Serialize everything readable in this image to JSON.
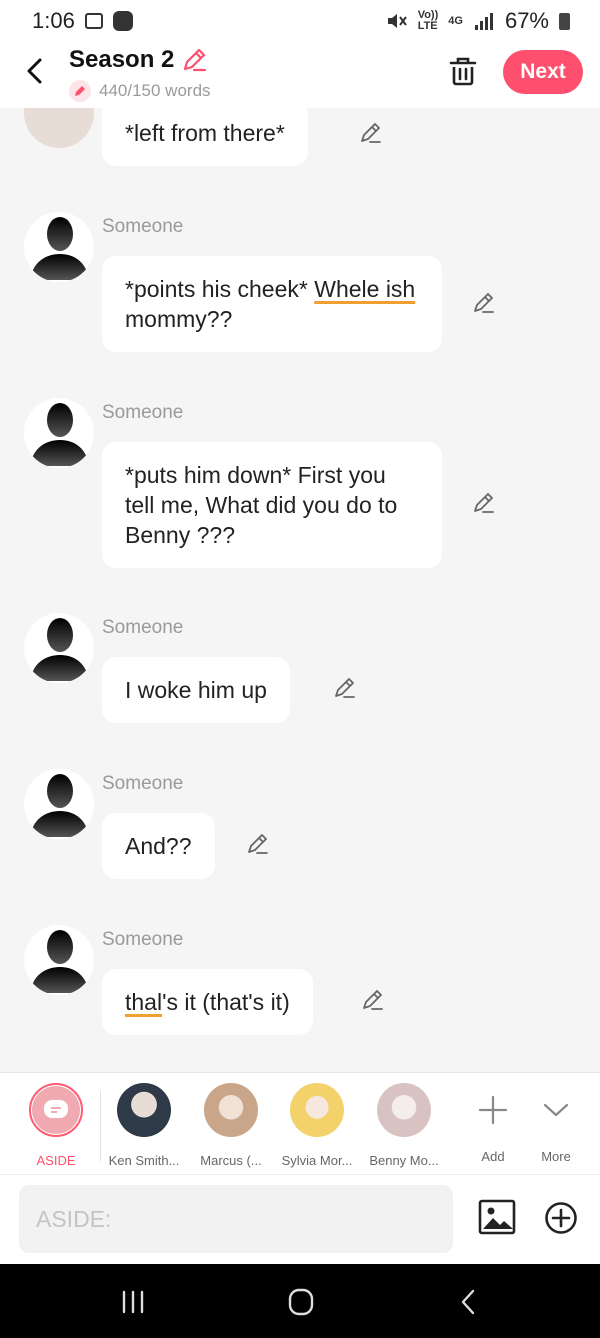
{
  "status_bar": {
    "time": "1:06",
    "network": "4G",
    "lte_top": "Vo))",
    "lte_bottom": "LTE",
    "battery": "67%"
  },
  "header": {
    "title": "Season 2",
    "word_count": "440/150 words",
    "next_label": "Next"
  },
  "messages": [
    {
      "speaker": "",
      "text": "*left from there*"
    },
    {
      "speaker": "Someone",
      "text_before": "*points his cheek* ",
      "text_underlined": "Whele ish",
      "text_after": " mommy??"
    },
    {
      "speaker": "Someone",
      "text": "*puts him down* First you tell me, What did you do to Benny ???"
    },
    {
      "speaker": "Someone",
      "text": "I woke him up"
    },
    {
      "speaker": "Someone",
      "text": "And??"
    },
    {
      "speaker": "Someone",
      "text_underlined": "thal",
      "text_after": "'s it (that's it)"
    }
  ],
  "characters": [
    {
      "label": "ASIDE",
      "selected": true,
      "color": "#ff4f6e"
    },
    {
      "label": "Ken Smith...",
      "color": "#2f3a48"
    },
    {
      "label": "Marcus (...",
      "color": "#c9a68a"
    },
    {
      "label": "Sylvia Mor...",
      "color": "#f3d26b"
    },
    {
      "label": "Benny Mo...",
      "color": "#e8d5d5"
    },
    {
      "label": "Add",
      "icon": "plus-icon"
    },
    {
      "label": "More",
      "icon": "chevron-down-icon"
    }
  ],
  "input": {
    "placeholder": "ASIDE:"
  },
  "colors": {
    "accent": "#ff4f6e",
    "background": "#f5f5f5",
    "bubble": "#ffffff",
    "underline": "#f0a030"
  }
}
